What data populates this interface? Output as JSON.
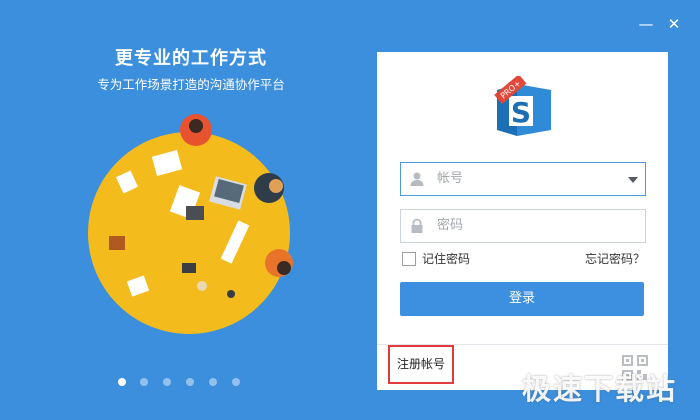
{
  "window": {
    "minimize_glyph": "—",
    "close_glyph": "✕",
    "background": "#3b8fdd"
  },
  "promo": {
    "title": "更专业的工作方式",
    "subtitle": "专为工作场景打造的沟通协作平台",
    "illustration": "circle-table-team-illustration",
    "carousel": {
      "count": 6,
      "active": 0
    }
  },
  "login": {
    "logo_badge": "PRO+",
    "logo_letter": "S",
    "account_placeholder": "帐号",
    "password_placeholder": "密码",
    "remember_label": "记住密码",
    "remember_checked": false,
    "forgot_label": "忘记密码？",
    "login_button": "登录",
    "register_label": "注册帐号",
    "accent": "#3d8fe0",
    "highlight": "#e23b3b"
  },
  "watermark": "极速下载站"
}
